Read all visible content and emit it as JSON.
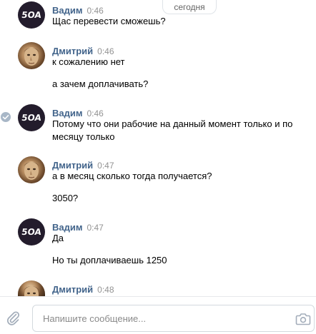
{
  "date_divider": "сегодня",
  "messages": [
    {
      "author": "Вадим",
      "time": "0:46",
      "avatar": "vadim",
      "lines": [
        "Щас перевести сможешь?"
      ]
    },
    {
      "author": "Дмитрий",
      "time": "0:46",
      "avatar": "dmitry",
      "lines": [
        "к сожалению нет",
        "а зачем доплачивать?"
      ]
    },
    {
      "author": "Вадим",
      "time": "0:46",
      "avatar": "vadim",
      "read_check": true,
      "lines": [
        "Потому что они рабочие на данный момент только и по месяцу только"
      ]
    },
    {
      "author": "Дмитрий",
      "time": "0:47",
      "avatar": "dmitry",
      "lines": [
        "а в месяц сколько тогда получается?",
        "3050?"
      ]
    },
    {
      "author": "Вадим",
      "time": "0:47",
      "avatar": "vadim",
      "lines": [
        "Да",
        "Но ты доплачиваешь 1250"
      ]
    },
    {
      "author": "Дмитрий",
      "time": "0:48",
      "avatar": "dmitry",
      "lines": []
    }
  ],
  "vadim_logo_text": "SOA",
  "composer": {
    "placeholder": "Напишите сообщение...",
    "attach_icon": "paperclip-icon",
    "camera_icon": "camera-icon"
  },
  "colors": {
    "author": "#42648b",
    "time": "#939393",
    "text": "#000000",
    "vadim_avatar": "#231c2c"
  }
}
